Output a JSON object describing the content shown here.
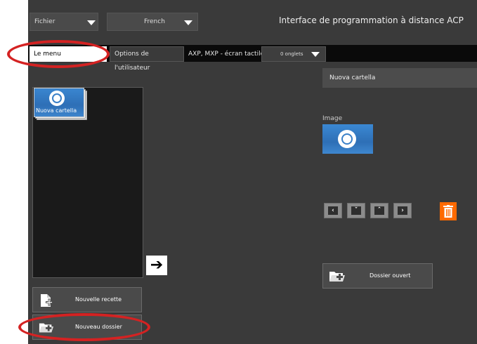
{
  "topbar": {
    "file_menu": "Fichier",
    "language": "French",
    "app_title": "Interface de programmation à distance ACP"
  },
  "tabs": {
    "menu": "Le menu",
    "user_options": "Options de l'utilisateur",
    "device": "AXP, MXP - écran tactile",
    "onglets": "0 onglets"
  },
  "left_panel": {
    "folder_label": "Nuova cartella"
  },
  "buttons": {
    "new_recipe": "Nouvelle recette",
    "new_folder": "Nouveau dossier",
    "open_folder": "Dossier ouvert"
  },
  "right_panel": {
    "header": "Nuova cartella",
    "image_label": "Image"
  },
  "colors": {
    "background": "#3a3a3a",
    "accent_blue": "#2e6fb6",
    "trash_orange": "#ff6a00",
    "highlight_red": "#d42222"
  }
}
